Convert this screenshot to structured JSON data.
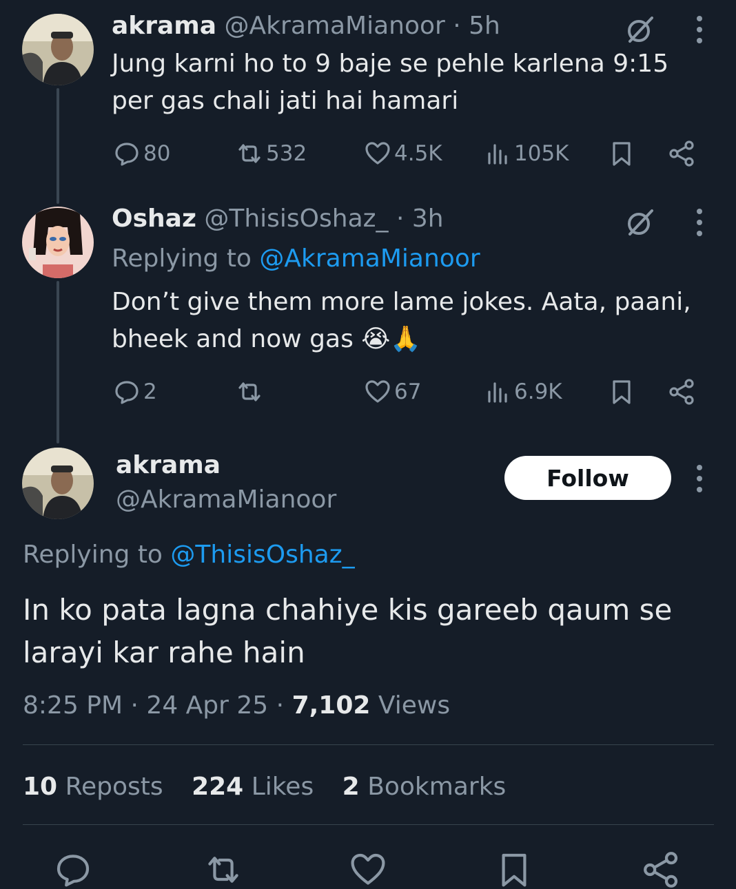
{
  "tweet1": {
    "name": "akrama",
    "handle": "@AkramaMianoor",
    "time": "· 5h",
    "text_line1": "Jung karni ho to 9 baje se pehle karlena 9:15",
    "text_line2": "per gas chali jati hai hamari",
    "replies": "80",
    "reposts": "532",
    "likes": "4.5K",
    "views": "105K"
  },
  "tweet2": {
    "name": "Oshaz",
    "handle": "@ThisisOshaz_",
    "time": "· 3h",
    "replying_prefix": "Replying to ",
    "replying_handle": "@AkramaMianoor",
    "text_line1": "Don’t give them more lame jokes. Aata, paani,",
    "text_line2": "bheek and now gas 😭🙏",
    "replies": "2",
    "likes": "67",
    "views": "6.9K"
  },
  "main": {
    "name": "akrama",
    "handle": "@AkramaMianoor",
    "follow_label": "Follow",
    "replying_prefix": "Replying to ",
    "replying_handle": "@ThisisOshaz_",
    "text_line1": "In ko pata lagna chahiye kis gareeb qaum se",
    "text_line2": "larayi kar rahe hain",
    "time": "8:25 PM",
    "date": "24 Apr 25",
    "views_count": "7,102",
    "views_label": "Views",
    "reposts_count": "10",
    "reposts_label": "Reposts",
    "likes_count": "224",
    "likes_label": "Likes",
    "bookmarks_count": "2",
    "bookmarks_label": "Bookmarks"
  },
  "colors": {
    "background": "#151d28",
    "link": "#1d9bf0",
    "muted": "#8b98a5"
  }
}
